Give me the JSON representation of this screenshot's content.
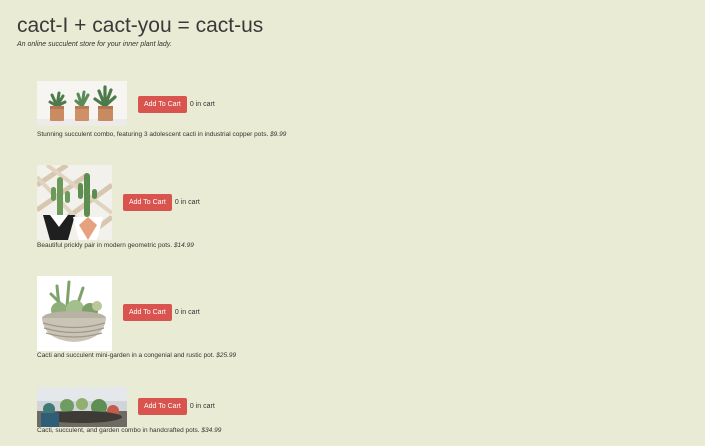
{
  "header": {
    "title": "cact-I + cact-you = cact-us",
    "subtitle": "An online succulent store for your inner plant lady."
  },
  "products": [
    {
      "button_label": "Add To Cart",
      "cart_count": "0",
      "cart_suffix": "in cart",
      "description": "Stunning succulent combo, featuring 3 adolescent cacti in industrial copper pots.",
      "price": "$9.99"
    },
    {
      "button_label": "Add To Cart",
      "cart_count": "0",
      "cart_suffix": "in cart",
      "description": "Beautiful prickly pair in modern geometric pots.",
      "price": "$14.99"
    },
    {
      "button_label": "Add To Cart",
      "cart_count": "0",
      "cart_suffix": "in cart",
      "description": "Cacti and succulent mini-garden in a congenial and rustic pot.",
      "price": "$25.99"
    },
    {
      "button_label": "Add To Cart",
      "cart_count": "0",
      "cart_suffix": "in cart",
      "description": "Cacti, succulent, and garden combo in handcrafted pots.",
      "price": "$34.99"
    }
  ]
}
